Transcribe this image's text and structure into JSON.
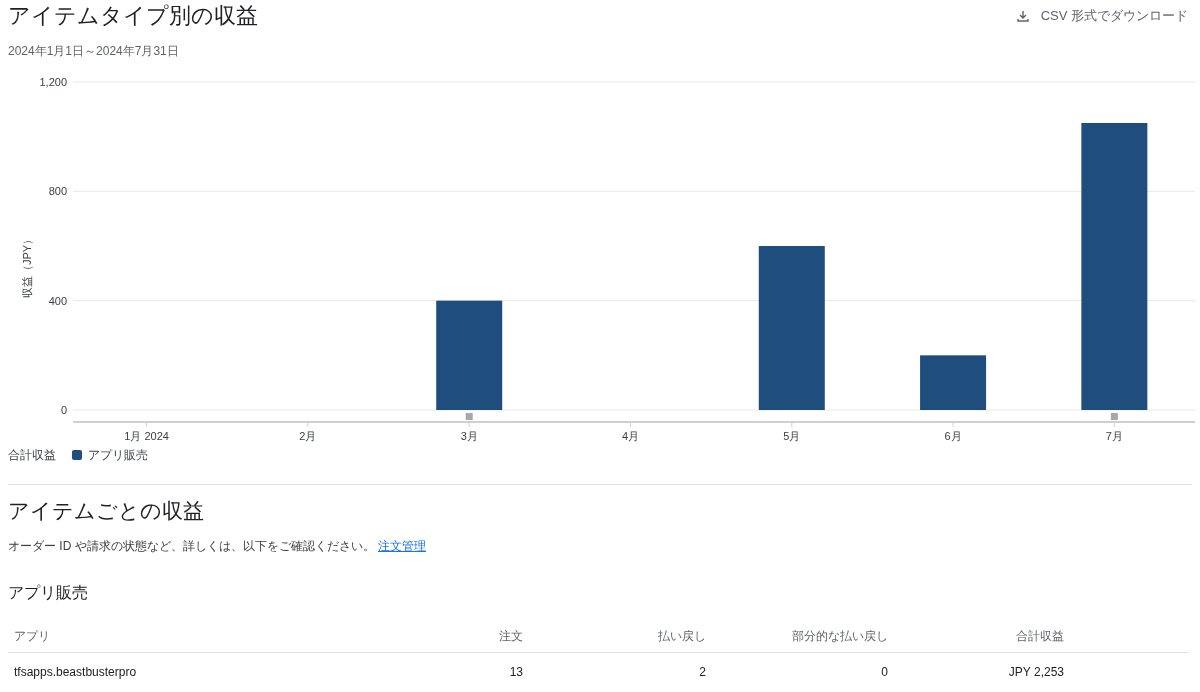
{
  "header": {
    "title": "アイテムタイプ別の収益",
    "date_range": "2024年1月1日～2024年7月31日",
    "download_label": "CSV 形式でダウンロード"
  },
  "chart": {
    "chart_data": {
      "type": "bar",
      "ylabel": "収益（JPY）",
      "categories": [
        "1月 2024",
        "2月",
        "3月",
        "4月",
        "5月",
        "6月",
        "7月"
      ],
      "series": [
        {
          "name": "アプリ販売",
          "color": "#1f4e7e",
          "values": [
            0,
            0,
            400,
            0,
            600,
            200,
            1050
          ]
        }
      ],
      "ylim": [
        0,
        1200
      ],
      "yticks": [
        {
          "value": 0,
          "label": "0"
        },
        {
          "value": 400,
          "label": "400"
        },
        {
          "value": 800,
          "label": "800"
        },
        {
          "value": 1200,
          "label": "1,200"
        }
      ],
      "annotations": [
        {
          "x": "3月"
        },
        {
          "x": "7月"
        }
      ]
    },
    "legend_title": "合計収益"
  },
  "items_section": {
    "title": "アイテムごとの収益",
    "description": "オーダー ID や請求の状態など、詳しくは、以下をご確認ください。",
    "link": "注文管理"
  },
  "table": {
    "title": "アプリ販売",
    "columns": [
      "アプリ",
      "注文",
      "払い戻し",
      "部分的な払い戻し",
      "合計収益"
    ],
    "rows": [
      [
        "tfsapps.beastbusterpro",
        "13",
        "2",
        "0",
        "JPY 2,253"
      ]
    ]
  }
}
